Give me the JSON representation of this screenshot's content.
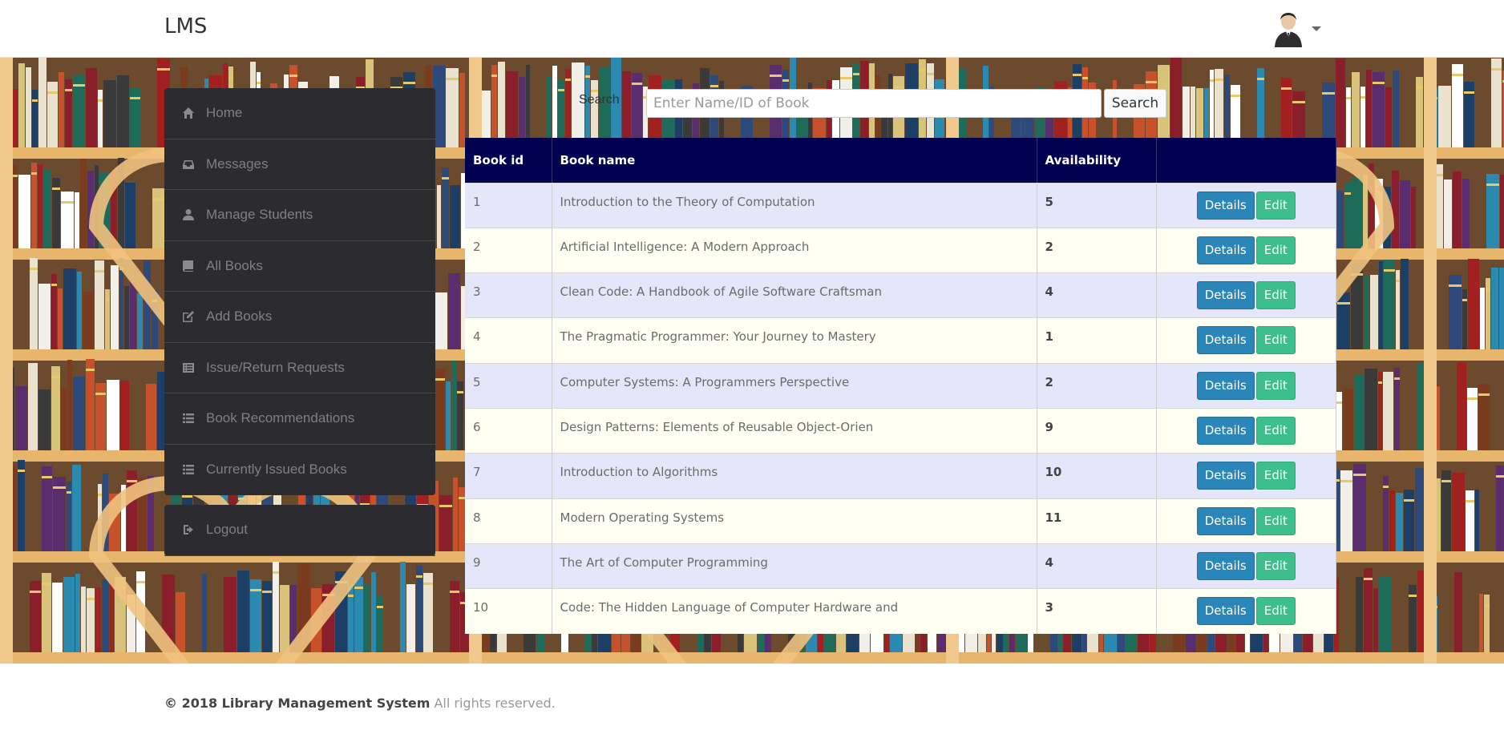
{
  "header": {
    "brand": "LMS",
    "avatar_icon": "user-avatar-icon",
    "caret_icon": "caret-down-icon"
  },
  "sidebar": {
    "items": [
      {
        "label": "Home",
        "icon": "home-icon"
      },
      {
        "label": "Messages",
        "icon": "inbox-icon"
      },
      {
        "label": "Manage Students",
        "icon": "user-icon"
      },
      {
        "label": "All Books",
        "icon": "book-icon"
      },
      {
        "label": "Add Books",
        "icon": "edit-icon"
      },
      {
        "label": "Issue/Return Requests",
        "icon": "list-alt-icon"
      },
      {
        "label": "Book Recommendations",
        "icon": "list-icon"
      },
      {
        "label": "Currently Issued Books",
        "icon": "list-icon"
      }
    ],
    "logout": {
      "label": "Logout",
      "icon": "logout-icon"
    }
  },
  "search": {
    "label": "Search",
    "placeholder": "Enter Name/ID of Book",
    "button": "Search"
  },
  "table": {
    "headers": [
      "Book id",
      "Book name",
      "Availability",
      ""
    ],
    "details_label": "Details",
    "edit_label": "Edit",
    "rows": [
      {
        "id": "1",
        "name": "Introduction to the Theory of Computation",
        "availability": "5"
      },
      {
        "id": "2",
        "name": "Artificial Intelligence: A Modern Approach",
        "availability": "2"
      },
      {
        "id": "3",
        "name": "Clean Code: A Handbook of Agile Software Craftsman",
        "availability": "4"
      },
      {
        "id": "4",
        "name": "The Pragmatic Programmer: Your Journey to Mastery",
        "availability": "1"
      },
      {
        "id": "5",
        "name": "Computer Systems: A Programmers Perspective",
        "availability": "2"
      },
      {
        "id": "6",
        "name": "Design Patterns: Elements of Reusable Object-Orien",
        "availability": "9"
      },
      {
        "id": "7",
        "name": "Introduction to Algorithms",
        "availability": "10"
      },
      {
        "id": "8",
        "name": "Modern Operating Systems",
        "availability": "11"
      },
      {
        "id": "9",
        "name": "The Art of Computer Programming",
        "availability": "4"
      },
      {
        "id": "10",
        "name": "Code: The Hidden Language of Computer Hardware and",
        "availability": "3"
      }
    ]
  },
  "footer": {
    "copyright": "© 2018 Library Management System",
    "rights": "All rights reserved."
  },
  "colors": {
    "table_header": "#000050",
    "row_odd": "#e6e6fa",
    "row_even": "#fffff2",
    "details_button": "#2a86b8",
    "edit_button": "#3cbf8a",
    "sidebar": "#2b2b30"
  }
}
